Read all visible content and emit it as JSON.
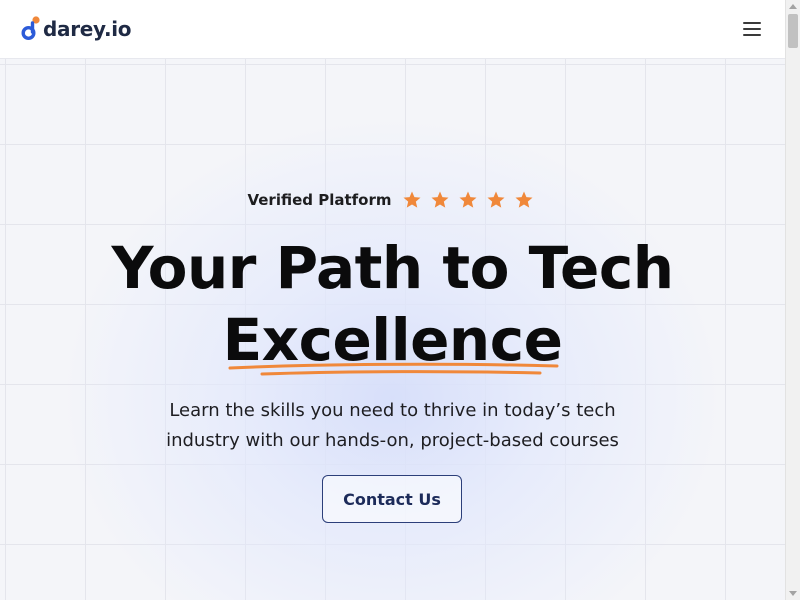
{
  "header": {
    "logo_text": "darey.io",
    "menu_icon": "hamburger-menu-icon"
  },
  "hero": {
    "verified_label": "Verified Platform",
    "rating": {
      "stars": 5,
      "icon": "star-icon",
      "color": "#f0883a"
    },
    "headline_line1": "Your Path to Tech",
    "headline_line2": "Excellence",
    "subtitle_line1": "Learn the skills you need to thrive in today’s tech",
    "subtitle_line2": "industry with our hands-on, project-based courses",
    "cta_label": "Contact Us"
  },
  "colors": {
    "brand_orange": "#f0883a",
    "brand_blue": "#2c5bd8",
    "text_dark": "#0b0b0c",
    "button_border": "#2c3f7a"
  }
}
